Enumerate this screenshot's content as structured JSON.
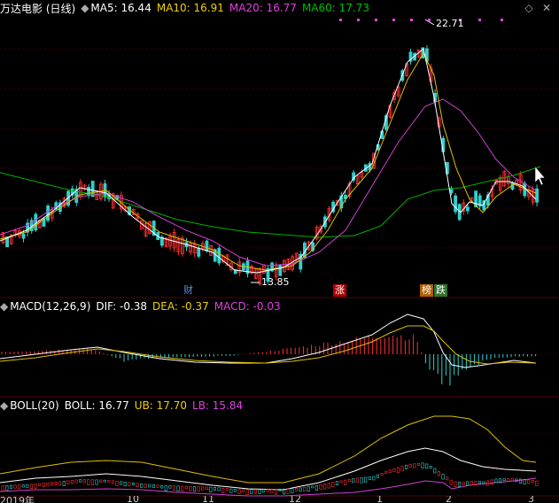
{
  "header": {
    "title": "万达电影 (日线)",
    "ma_toggle": "◆",
    "ma5": "MA5: 16.44",
    "ma10": "MA10: 16.91",
    "ma20": "MA20: 16.77",
    "ma60": "MA60: 17.73",
    "colors": {
      "ma5": "#ffffff",
      "ma10": "#f0d000",
      "ma20": "#e040e0",
      "ma60": "#00c000"
    }
  },
  "price_panel": {
    "high_label": "22.71",
    "low_label": "13.85",
    "markers": [
      {
        "text": "财",
        "color": "#5b8fd6"
      },
      {
        "text": "涨",
        "color": "#ff4040"
      },
      {
        "text": "榜",
        "color": "#e0a040"
      },
      {
        "text": "跌",
        "color": "#40c040"
      }
    ]
  },
  "macd_panel": {
    "label": "MACD(12,26,9)",
    "dif": "DIF: -0.38",
    "dea": "DEA: -0.37",
    "macd": "MACD: -0.03"
  },
  "boll_panel": {
    "label": "BOLL(20)",
    "boll": "BOLL: 16.77",
    "ub": "UB: 17.70",
    "lb": "LB: 15.84"
  },
  "x_axis": {
    "ticks": [
      "2019年",
      "10",
      "11",
      "12",
      "1",
      "2",
      "3"
    ]
  }
}
